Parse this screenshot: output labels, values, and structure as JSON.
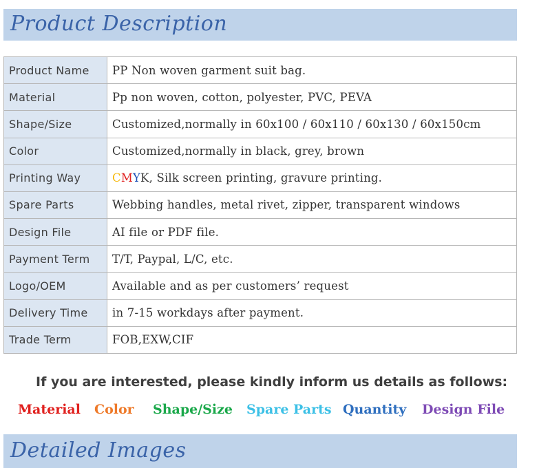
{
  "header": {
    "title": "Product Description"
  },
  "spec_rows": [
    {
      "key": "Product Name",
      "value": "PP Non woven garment suit bag."
    },
    {
      "key": "Material",
      "value": "Pp non woven, cotton, polyester, PVC, PEVA"
    },
    {
      "key": "Shape/Size",
      "value": "Customized,normally in 60x100 / 60x110 / 60x130 / 60x150cm"
    },
    {
      "key": "Color",
      "value": "Customized,normally in black, grey, brown"
    },
    {
      "key": "Printing Way",
      "value_prefix": [
        "C",
        "M",
        "Y",
        "K"
      ],
      "value": ", Silk screen printing, gravure printing."
    },
    {
      "key": "Spare Parts",
      "value": "Webbing handles, metal rivet, zipper, transparent windows"
    },
    {
      "key": "Design File",
      "value": "AI file or PDF file."
    },
    {
      "key": "Payment Term",
      "value": "T/T, Paypal, L/C, etc."
    },
    {
      "key": "Logo/OEM",
      "value": "Available and as per customers’ request"
    },
    {
      "key": "Delivery Time",
      "value": "in 7-15 workdays after payment."
    },
    {
      "key": "Trade Term",
      "value": "FOB,EXW,CIF"
    }
  ],
  "inquiry": {
    "note": "If you are interested, please kindly inform us details as follows:",
    "items": [
      {
        "label": "Material",
        "color": "#e0201e"
      },
      {
        "label": "Color",
        "color": "#ee7a2a"
      },
      {
        "label": "Shape/Size",
        "color": "#1aa84a"
      },
      {
        "label": "Spare Parts",
        "color": "#3cc0e6"
      },
      {
        "label": "Quantity",
        "color": "#2f6fbf"
      },
      {
        "label": "Design File",
        "color": "#7e4bb5"
      }
    ]
  },
  "footer": {
    "title": "Detailed Images"
  },
  "colors": {
    "banner": "#bfd3ea",
    "key_cell": "#dce6f2",
    "title": "#3a63a8"
  }
}
